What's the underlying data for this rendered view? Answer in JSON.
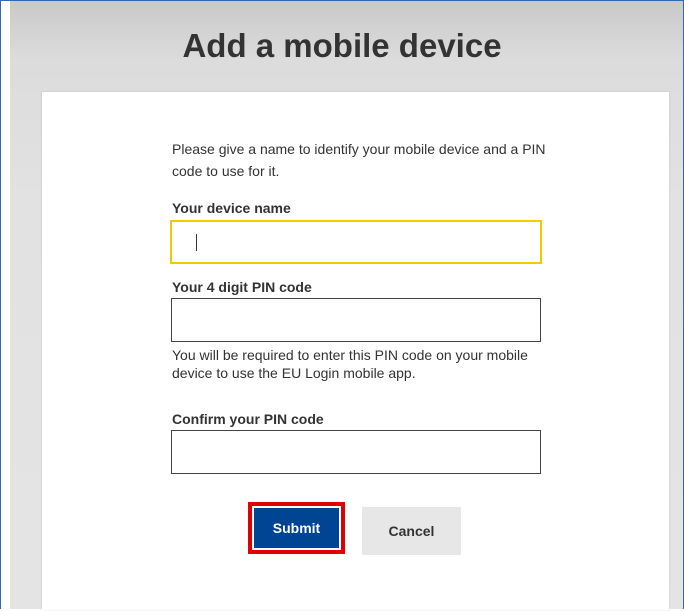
{
  "page": {
    "title": "Add a mobile device"
  },
  "form": {
    "intro": "Please give a name to identify your mobile device and a PIN code to use for it.",
    "device_name": {
      "label": "Your device name",
      "value": ""
    },
    "pin": {
      "label": "Your 4 digit PIN code",
      "value": "",
      "help": "You will be required to enter this PIN code on your mobile device to use the EU Login mobile app."
    },
    "confirm_pin": {
      "label": "Confirm your PIN code",
      "value": ""
    },
    "submit_label": "Submit",
    "cancel_label": "Cancel"
  },
  "colors": {
    "primary": "#004494",
    "focus_border": "#f5c800",
    "highlight": "#e00000"
  }
}
